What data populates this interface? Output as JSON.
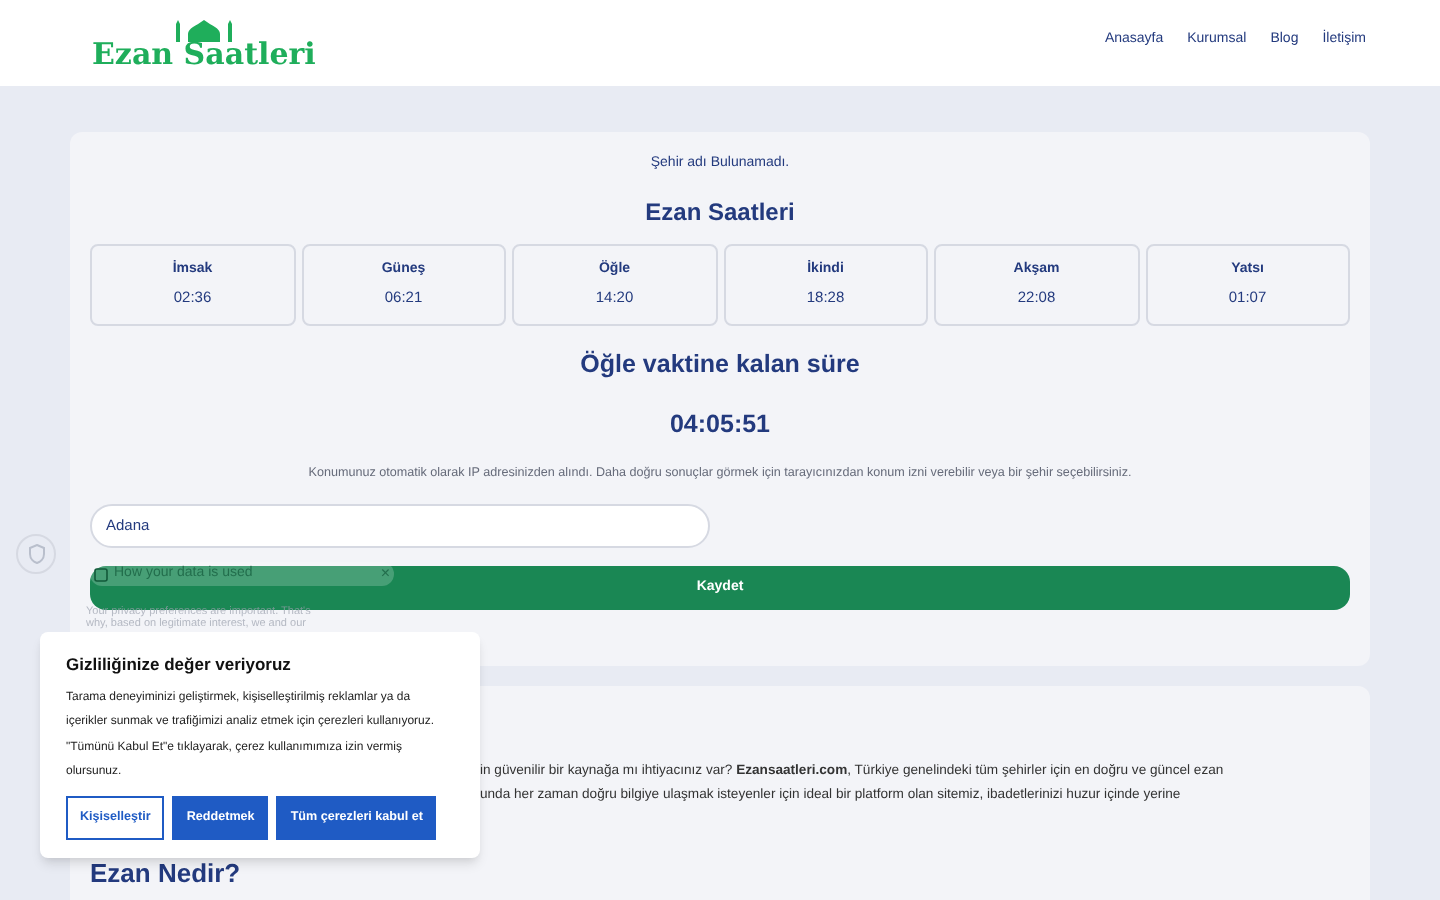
{
  "header": {
    "logo": "Ezan Saatleri",
    "nav": [
      {
        "label": "Anasayfa"
      },
      {
        "label": "Kurumsal"
      },
      {
        "label": "Blog"
      },
      {
        "label": "İletişim"
      }
    ]
  },
  "city_notice": "Şehir adı Bulunamadı.",
  "title": "Ezan Saatleri",
  "prayers": [
    {
      "name": "İmsak",
      "time": "02:36"
    },
    {
      "name": "Güneş",
      "time": "06:21"
    },
    {
      "name": "Öğle",
      "time": "14:20"
    },
    {
      "name": "İkindi",
      "time": "18:28"
    },
    {
      "name": "Akşam",
      "time": "22:08"
    },
    {
      "name": "Yatsı",
      "time": "01:07"
    }
  ],
  "countdown": {
    "title": "Öğle vaktine kalan süre",
    "time": "04:05:51"
  },
  "location_note": "Konumunuz otomatik olarak IP adresinizden alındı. Daha doğru sonuçlar görmek için tarayıcınızdan konum izni verebilir veya bir şehir seçebilirsiniz.",
  "city_field": {
    "value": "Adana"
  },
  "save_button": "Kaydet",
  "data_notice": {
    "title": "How your data is used",
    "close": "×",
    "lines": [
      "Your privacy preferences are important. That's",
      "why, based on legitimate interest, we and our"
    ]
  },
  "intro_lines": [
    "in güvenilir bir kaynağa mı ihtiyacınız var? **Ezansaatleri.com**, Türkiye genelindeki tüm şehirler için en doğru ve güncel ezan",
    "unda her zaman doğru bilgiye ulaşmak isteyenler için ideal bir platform olan sitemiz, ibadetlerinizi huzur içinde yerine"
  ],
  "section_heading": "Ezan Nedir?",
  "cookie": {
    "title": "Gizliliğinize değer veriyoruz",
    "text": "Tarama deneyiminizi geliştirmek, kişiselleştirilmiş reklamlar ya da içerikler sunmak ve trafiğimizi analiz etmek için çerezleri kullanıyoruz. \"Tümünü Kabul Et\"e tıklayarak, çerez kullanımımıza izin vermiş olursunuz.",
    "buttons": [
      {
        "label": "Kişiselleştir",
        "kind": "outline"
      },
      {
        "label": "Reddetmek",
        "kind": "solid"
      },
      {
        "label": "Tüm çerezleri kabul et",
        "kind": "solid"
      }
    ]
  }
}
